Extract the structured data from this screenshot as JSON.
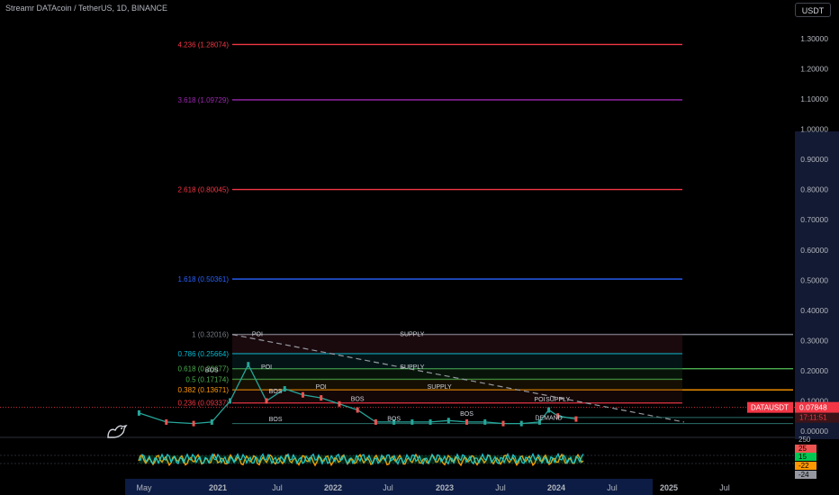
{
  "header": {
    "title": "Streamr DATAcoin / TetherUS, 1D, BINANCE",
    "currency_button": "USDT"
  },
  "price_axis": {
    "ticks": [
      "1.30000",
      "1.20000",
      "1.10000",
      "1.00000",
      "0.90000",
      "0.80000",
      "0.70000",
      "0.60000",
      "0.50000",
      "0.40000",
      "0.30000",
      "0.20000",
      "0.10000",
      "0.00000"
    ],
    "current_price_label": "0.07848",
    "current_symbol_label": "DATAUSDT",
    "countdown": "17:11:51"
  },
  "indicator_axis": {
    "ticks": [
      "250",
      "25",
      "15",
      "-22",
      "-24"
    ]
  },
  "time_axis": {
    "ticks": [
      "May",
      "2021",
      "Jul",
      "2022",
      "Jul",
      "2023",
      "Jul",
      "2024",
      "Jul",
      "2025",
      "Jul"
    ]
  },
  "colors": {
    "background": "#000000",
    "candles_up": "#26a69a",
    "candles_down": "#ef5350",
    "current_price": "#f23645",
    "fib_4236": "#f23645",
    "fib_3618": "#9c27b0",
    "fib_2618": "#f23645",
    "fib_1618": "#2962ff",
    "fib_1": "#787b86",
    "fib_0786": "#00bcd4",
    "fib_0618": "#4caf50",
    "fib_05": "#4caf50",
    "fib_0382": "#ff9800",
    "fib_0236": "#f23645",
    "indicator_lime": "#00e676",
    "indicator_orange": "#ff9800"
  },
  "chart_data": {
    "type": "line",
    "title": "Streamr DATAcoin / TetherUS, 1D, BINANCE",
    "ylim": [
      0,
      1.36
    ],
    "x": [
      "2020-05",
      "2020-08",
      "2020-11",
      "2021-01",
      "2021-03",
      "2021-05",
      "2021-07",
      "2021-09",
      "2021-11",
      "2022-01",
      "2022-03",
      "2022-05",
      "2022-07",
      "2022-09",
      "2022-11",
      "2023-01",
      "2023-03",
      "2023-05",
      "2023-07",
      "2023-09",
      "2023-11",
      "2024-01",
      "2024-02",
      "2024-03",
      "2024-05"
    ],
    "series": [
      {
        "values": [
          0.06,
          0.03,
          0.025,
          0.03,
          0.1,
          0.22,
          0.1,
          0.14,
          0.12,
          0.11,
          0.09,
          0.07,
          0.03,
          0.03,
          0.03,
          0.03,
          0.035,
          0.03,
          0.03,
          0.025,
          0.025,
          0.03,
          0.07,
          0.05,
          0.04
        ]
      }
    ],
    "fib_levels": [
      {
        "label": "4.236 (1.28074)",
        "value": 1.28074
      },
      {
        "label": "3.618 (1.09729)",
        "value": 1.09729
      },
      {
        "label": "2.618 (0.80045)",
        "value": 0.80045
      },
      {
        "label": "1.618 (0.50361)",
        "value": 0.50361
      },
      {
        "label": "1 (0.32016)",
        "value": 0.32016
      },
      {
        "label": "0.786 (0.25664)",
        "value": 0.25664
      },
      {
        "label": "0.618 (0.20677)",
        "value": 0.20677
      },
      {
        "label": "0.5 (0.17174)",
        "value": 0.17174
      },
      {
        "label": "0.382 (0.13671)",
        "value": 0.13671
      },
      {
        "label": "0.236 (0.09337)",
        "value": 0.09337
      }
    ],
    "current_price": 0.07848,
    "annotations": [
      {
        "text": "POI",
        "date": "2021-06",
        "value": 0.315
      },
      {
        "text": "SUPPLY",
        "date": "2022-11",
        "value": 0.315
      },
      {
        "text": "POI",
        "date": "2021-07",
        "value": 0.205
      },
      {
        "text": "SUPPLY",
        "date": "2022-11",
        "value": 0.205
      },
      {
        "text": "SUPPLY",
        "date": "2023-02",
        "value": 0.14
      },
      {
        "text": "POI",
        "date": "2022-01",
        "value": 0.14
      },
      {
        "text": "POI",
        "date": "2024-01",
        "value": 0.098
      },
      {
        "text": "SUPPLY",
        "date": "2024-03",
        "value": 0.098
      },
      {
        "text": "DEMAND",
        "date": "2024-02",
        "value": 0.038
      },
      {
        "text": "BOS",
        "date": "2021-01",
        "value": 0.195
      },
      {
        "text": "BOS",
        "date": "2021-08",
        "value": 0.125
      },
      {
        "text": "BOS",
        "date": "2022-05",
        "value": 0.1
      },
      {
        "text": "BOS",
        "date": "2022-09",
        "value": 0.035
      },
      {
        "text": "BOS",
        "date": "2023-05",
        "value": 0.05
      },
      {
        "text": "BOS",
        "date": "2021-08",
        "value": 0.033
      }
    ]
  }
}
